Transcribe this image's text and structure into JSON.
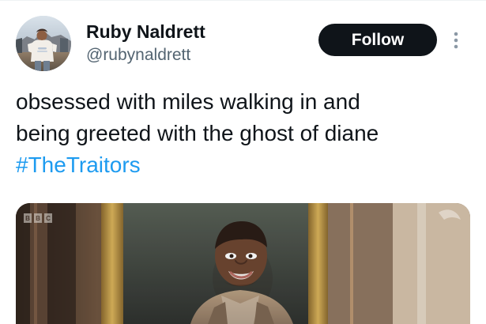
{
  "tweet": {
    "author": {
      "display_name": "Ruby Naldrett",
      "handle": "@rubynaldrett",
      "avatar_icon": "profile-photo"
    },
    "follow_label": "Follow",
    "more_icon": "vertical-ellipsis-icon",
    "text_lines": [
      "obsessed with miles walking in and",
      "being greeted with the ghost of diane"
    ],
    "hashtag": "#TheTraitors",
    "media": {
      "type": "video-still",
      "watermark_logo": "BBC"
    }
  },
  "colors": {
    "background": "#ffffff",
    "text_primary": "#0f1419",
    "text_secondary": "#536471",
    "follow_button_bg": "#0f1419",
    "follow_button_text": "#ffffff",
    "hashtag": "#1d9bf0"
  }
}
